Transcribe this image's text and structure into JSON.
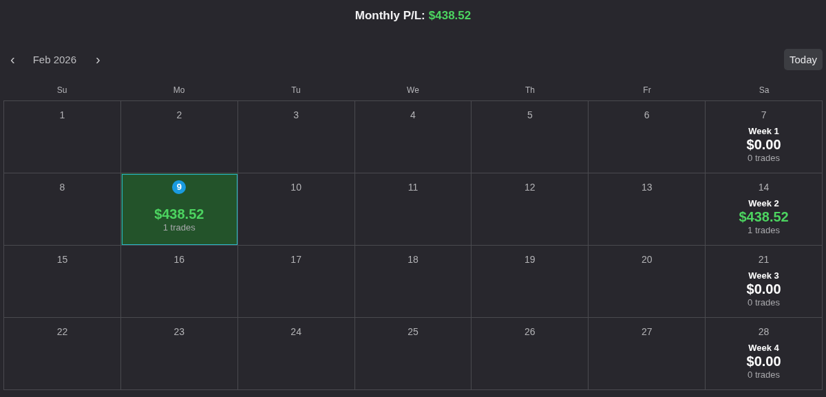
{
  "header": {
    "label": "Monthly P/L:",
    "value": "$438.52",
    "profit": true
  },
  "nav": {
    "prev": "‹",
    "month": "Feb 2026",
    "next": "›",
    "today_button": "Today"
  },
  "weekdays": [
    "Su",
    "Mo",
    "Tu",
    "We",
    "Th",
    "Fr",
    "Sa"
  ],
  "weeks": [
    {
      "days": [
        {
          "day": "1",
          "today": false
        },
        {
          "day": "2",
          "today": false
        },
        {
          "day": "3",
          "today": false
        },
        {
          "day": "4",
          "today": false
        },
        {
          "day": "5",
          "today": false
        },
        {
          "day": "6",
          "today": false
        },
        {
          "day": "7",
          "today": false
        }
      ],
      "summary": {
        "label": "Week 1",
        "pnl": "$0.00",
        "trades": "0 trades",
        "profit": false
      }
    },
    {
      "days": [
        {
          "day": "8",
          "today": false
        },
        {
          "day": "9",
          "today": true,
          "pnl": "$438.52",
          "trades": "1 trades",
          "profit": true
        },
        {
          "day": "10",
          "today": false
        },
        {
          "day": "11",
          "today": false
        },
        {
          "day": "12",
          "today": false
        },
        {
          "day": "13",
          "today": false
        },
        {
          "day": "14",
          "today": false
        }
      ],
      "summary": {
        "label": "Week 2",
        "pnl": "$438.52",
        "trades": "1 trades",
        "profit": true
      }
    },
    {
      "days": [
        {
          "day": "15",
          "today": false
        },
        {
          "day": "16",
          "today": false
        },
        {
          "day": "17",
          "today": false
        },
        {
          "day": "18",
          "today": false
        },
        {
          "day": "19",
          "today": false
        },
        {
          "day": "20",
          "today": false
        },
        {
          "day": "21",
          "today": false
        }
      ],
      "summary": {
        "label": "Week 3",
        "pnl": "$0.00",
        "trades": "0 trades",
        "profit": false
      }
    },
    {
      "days": [
        {
          "day": "22",
          "today": false
        },
        {
          "day": "23",
          "today": false
        },
        {
          "day": "24",
          "today": false
        },
        {
          "day": "25",
          "today": false
        },
        {
          "day": "26",
          "today": false
        },
        {
          "day": "27",
          "today": false
        },
        {
          "day": "28",
          "today": false
        }
      ],
      "summary": {
        "label": "Week 4",
        "pnl": "$0.00",
        "trades": "0 trades",
        "profit": false
      }
    }
  ]
}
